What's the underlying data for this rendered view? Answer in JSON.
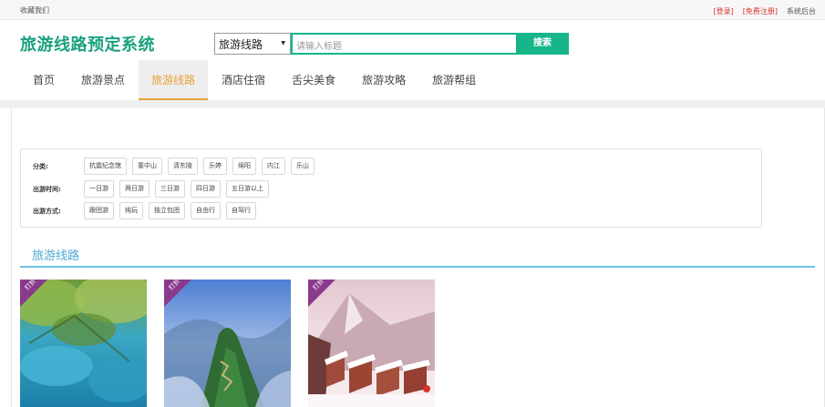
{
  "topbar": {
    "favorite": "收藏我们",
    "login": "[登录]",
    "register": "[免费注册]",
    "admin": "系统后台"
  },
  "header": {
    "logo": "旅游线路预定系统",
    "search": {
      "category": "旅游线路",
      "placeholder": "请输入标题",
      "button": "搜索"
    }
  },
  "nav": {
    "items": [
      "首页",
      "旅游景点",
      "旅游线路",
      "酒店住宿",
      "舌尖美食",
      "旅游攻略",
      "旅游帮组"
    ],
    "active_index": 2
  },
  "filters": {
    "category": {
      "label": "分类:",
      "options": [
        "抗震纪念馆",
        "童中山",
        "清东陵",
        "乐婷",
        "绵阳",
        "内江",
        "乐山"
      ]
    },
    "time": {
      "label": "出游时间:",
      "options": [
        "一日游",
        "两日游",
        "三日游",
        "四日游",
        "五日游以上"
      ]
    },
    "mode": {
      "label": "出游方式:",
      "options": [
        "跟团游",
        "纯玩",
        "独立包团",
        "自由行",
        "自驾行"
      ]
    }
  },
  "section": {
    "title": "旅游线路"
  },
  "cards": [
    {
      "badge": "打折",
      "scene": "jiuzhai-lake"
    },
    {
      "badge": "打折",
      "scene": "mountain-ridge"
    },
    {
      "badge": "打折",
      "scene": "snow-village"
    }
  ],
  "colors": {
    "brand_green": "#17b58a",
    "logo_green": "#1aa07e",
    "active_orange": "#e7a23a",
    "section_blue": "#4aa9d6",
    "ribbon_purple": "#8a3a8c",
    "link_red": "#d9312b"
  }
}
